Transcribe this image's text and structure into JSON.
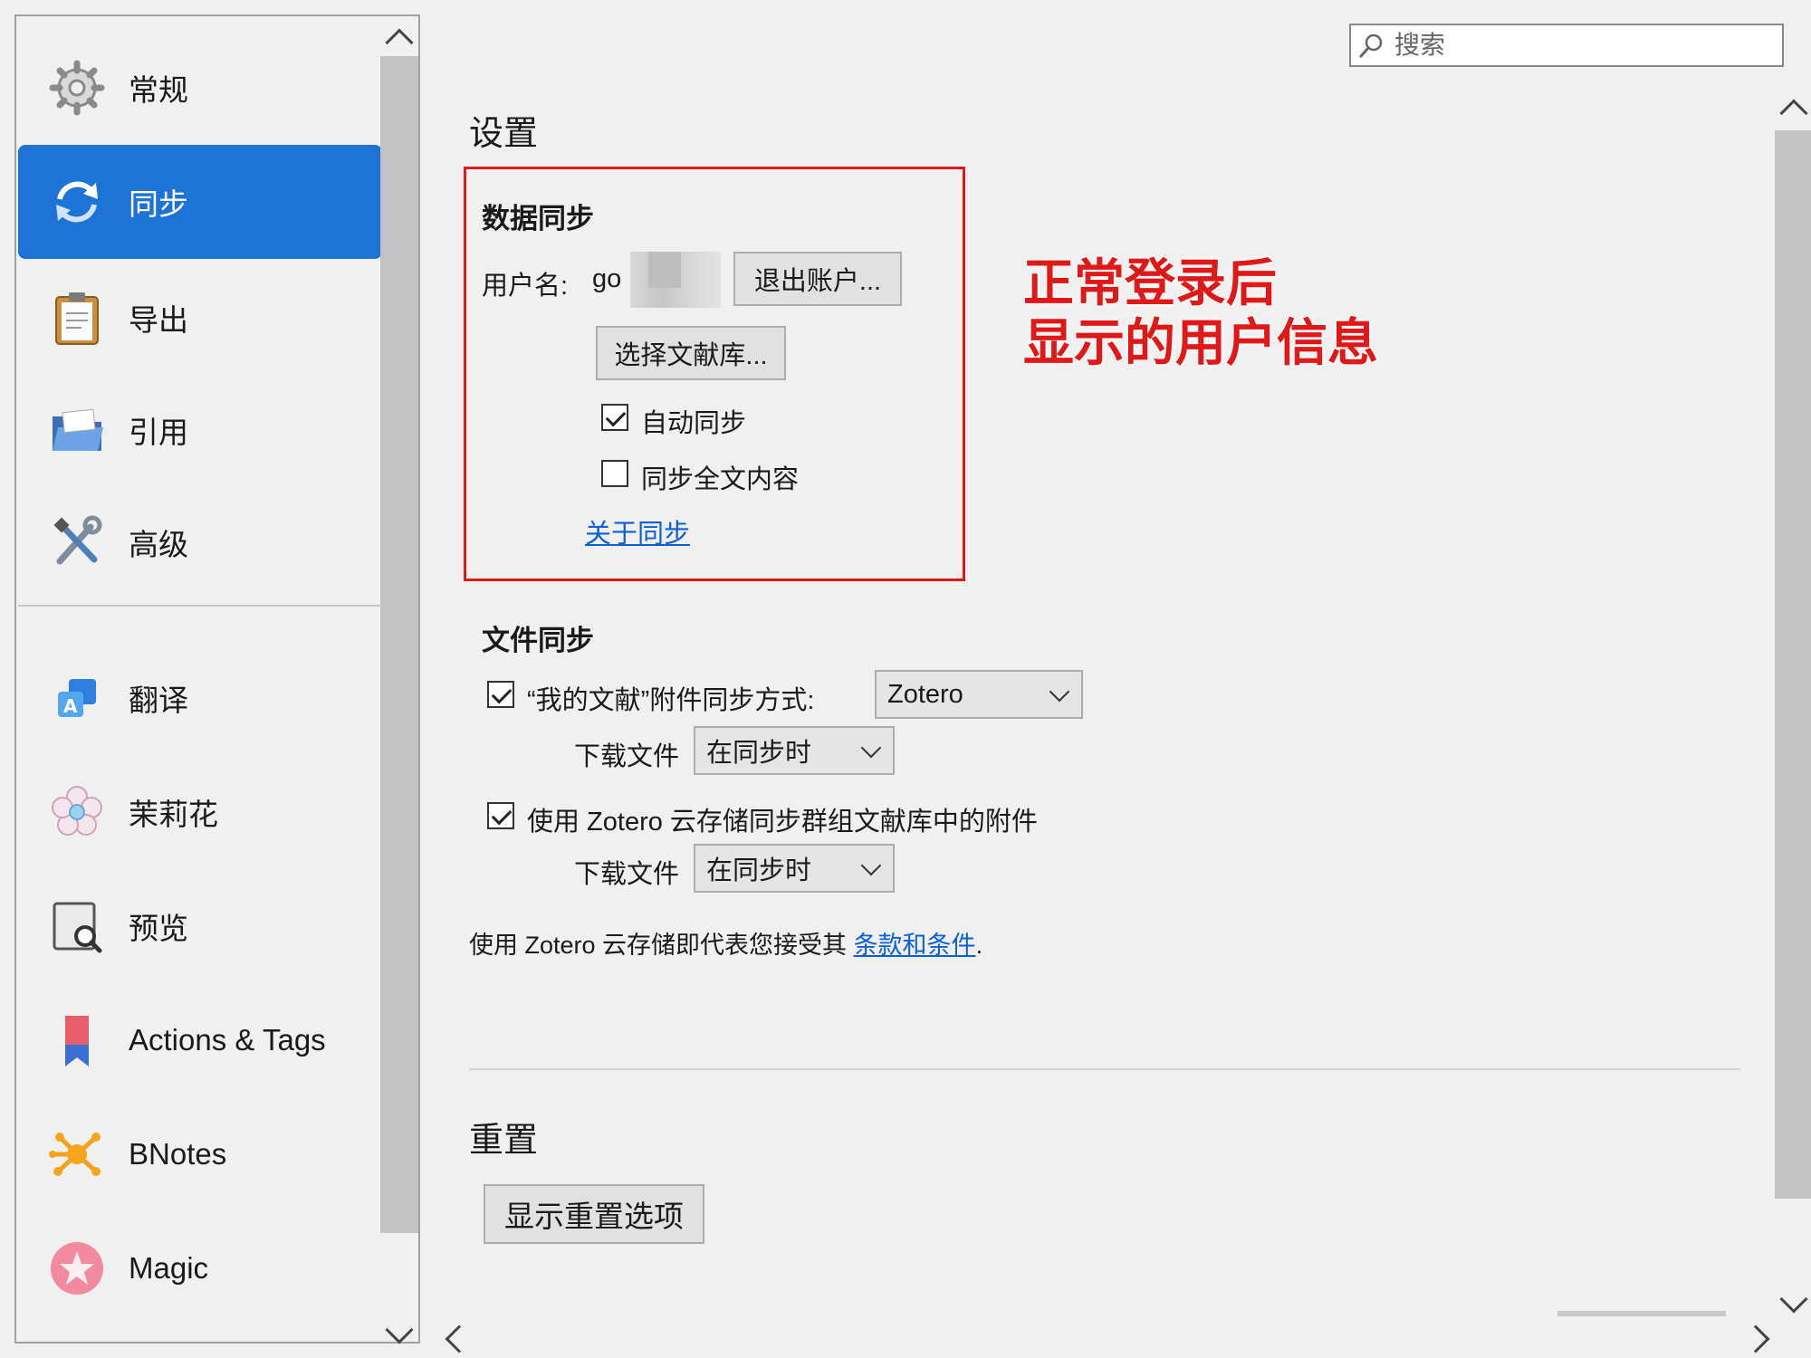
{
  "sidebar": {
    "items": [
      {
        "label": "常规",
        "icon": "gear-icon"
      },
      {
        "label": "同步",
        "icon": "sync-icon"
      },
      {
        "label": "导出",
        "icon": "clipboard-icon"
      },
      {
        "label": "引用",
        "icon": "folder-icon"
      },
      {
        "label": "高级",
        "icon": "tools-icon"
      },
      {
        "label": "翻译",
        "icon": "translate-icon"
      },
      {
        "label": "茉莉花",
        "icon": "jasmine-flower-icon"
      },
      {
        "label": "预览",
        "icon": "preview-icon"
      },
      {
        "label": "Actions & Tags",
        "icon": "bookmark-icon"
      },
      {
        "label": "BNotes",
        "icon": "bnotes-icon"
      },
      {
        "label": "Magic",
        "icon": "magic-icon"
      }
    ],
    "active": "同步"
  },
  "search": {
    "placeholder": "搜索"
  },
  "settings": {
    "title": "设置",
    "data_sync": {
      "heading": "数据同步",
      "username_label": "用户名:",
      "username_value": "go",
      "logout_button": "退出账户...",
      "choose_library_button": "选择文献库...",
      "auto_sync_label": "自动同步",
      "auto_sync_checked": true,
      "fulltext_sync_label": "同步全文内容",
      "fulltext_sync_checked": false,
      "about_link": "关于同步"
    },
    "annotation": {
      "line1": "正常登录后",
      "line2": "显示的用户信息"
    },
    "file_sync": {
      "heading": "文件同步",
      "my_library_label": "“我的文献”附件同步方式:",
      "my_library_checked": true,
      "my_library_method": "Zotero",
      "download_label_1": "下载文件",
      "download_value_1": "在同步时",
      "group_label": "使用 Zotero 云存储同步群组文献库中的附件",
      "group_checked": true,
      "download_label_2": "下载文件",
      "download_value_2": "在同步时",
      "terms_text": "使用 Zotero 云存储即代表您接受其",
      "terms_link": "条款和条件",
      "terms_end": "."
    },
    "reset": {
      "heading": "重置",
      "button": "显示重置选项"
    }
  },
  "colors": {
    "accent": "#1e73d6",
    "annotation": "#e01818",
    "link": "#0b5fd8"
  }
}
